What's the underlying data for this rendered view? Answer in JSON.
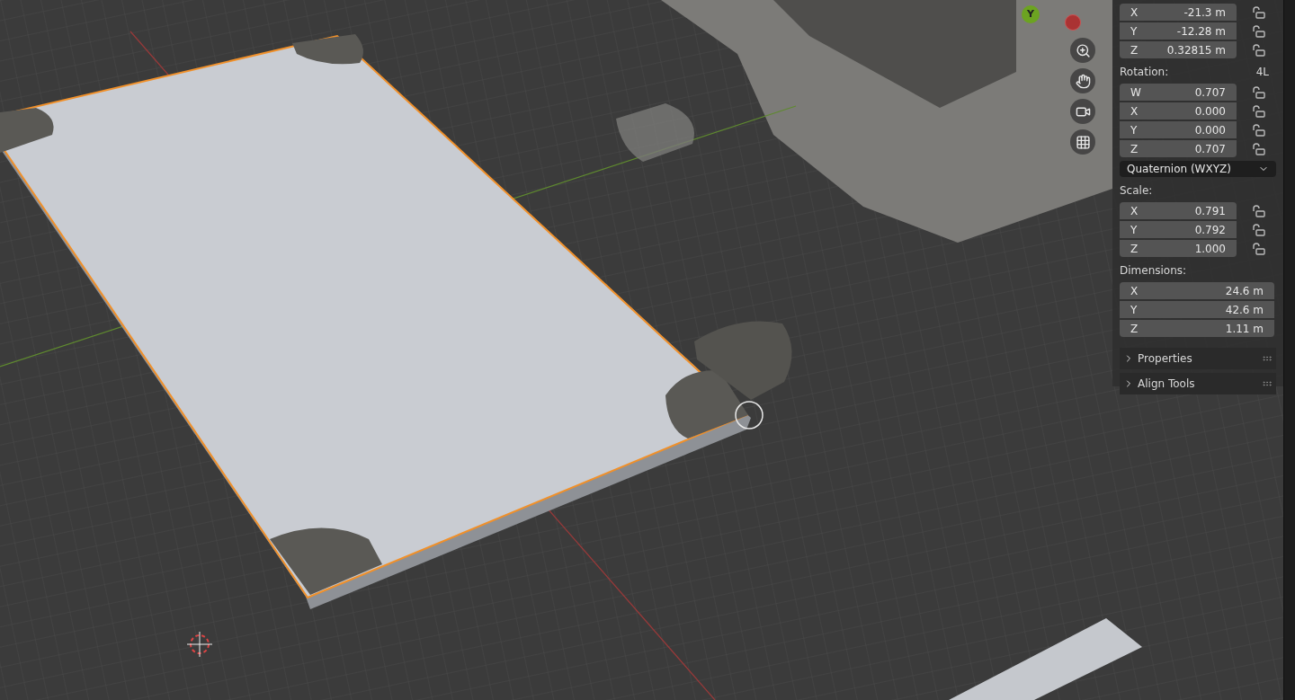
{
  "gizmo": {
    "axis_label": "Y"
  },
  "location": {
    "rows": [
      {
        "axis": "X",
        "value": "-21.3 m",
        "locked": false
      },
      {
        "axis": "Y",
        "value": "-12.28 m",
        "locked": false
      },
      {
        "axis": "Z",
        "value": "0.32815 m",
        "locked": false
      }
    ]
  },
  "rotation": {
    "label": "Rotation:",
    "mode_badge": "4L",
    "rows": [
      {
        "axis": "W",
        "value": "0.707",
        "locked": false
      },
      {
        "axis": "X",
        "value": "0.000",
        "locked": false
      },
      {
        "axis": "Y",
        "value": "0.000",
        "locked": false
      },
      {
        "axis": "Z",
        "value": "0.707",
        "locked": false
      }
    ],
    "mode": "Quaternion (WXYZ)"
  },
  "scale": {
    "label": "Scale:",
    "rows": [
      {
        "axis": "X",
        "value": "0.791",
        "locked": false
      },
      {
        "axis": "Y",
        "value": "0.792",
        "locked": false
      },
      {
        "axis": "Z",
        "value": "1.000",
        "locked": false
      }
    ]
  },
  "dimensions": {
    "label": "Dimensions:",
    "rows": [
      {
        "axis": "X",
        "value": "24.6 m"
      },
      {
        "axis": "Y",
        "value": "42.6 m"
      },
      {
        "axis": "Z",
        "value": "1.11 m"
      }
    ]
  },
  "panels": [
    {
      "title": "Properties",
      "expanded": false
    },
    {
      "title": "Align Tools",
      "expanded": false
    }
  ]
}
